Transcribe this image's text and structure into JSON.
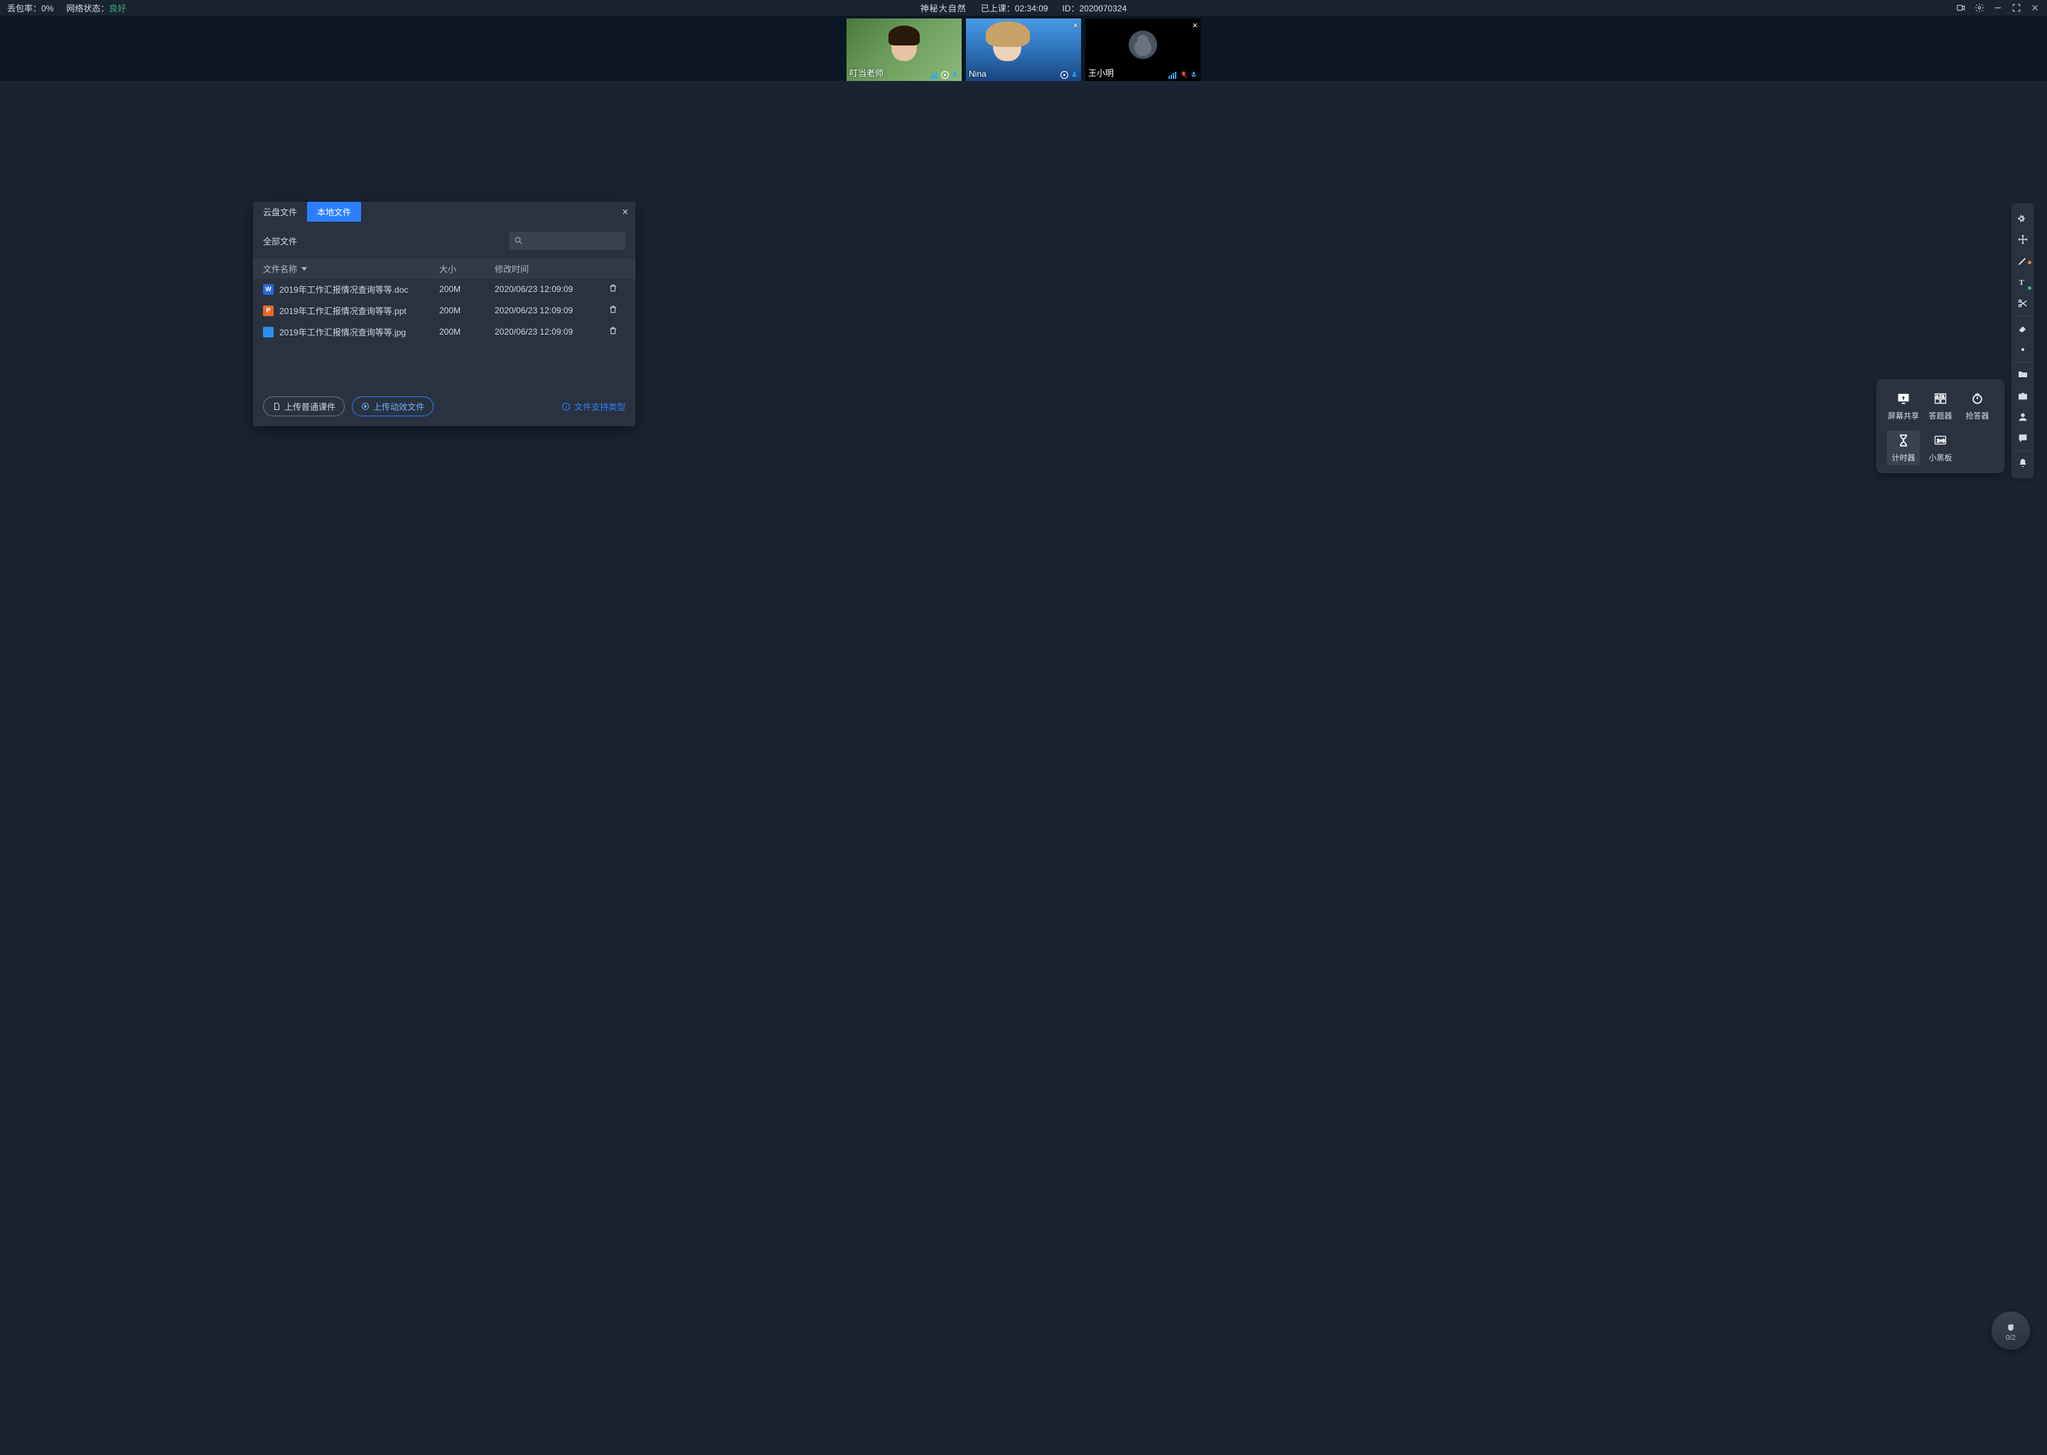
{
  "topbar": {
    "packet_loss_label": "丢包率：",
    "packet_loss_value": "0%",
    "network_label": "网络状态：",
    "network_value": "良好",
    "course_title": "神秘大自然",
    "elapsed_label": "已上课：",
    "elapsed_value": "02:34:09",
    "id_label": "ID：",
    "id_value": "2020070324"
  },
  "videos": [
    {
      "name": "叮当老师",
      "has_close": false,
      "camera_off": false,
      "mic_muted": false,
      "photo": 1
    },
    {
      "name": "Nina",
      "has_close": true,
      "camera_off": false,
      "mic_muted": false,
      "photo": 2
    },
    {
      "name": "王小明",
      "has_close": true,
      "camera_off": true,
      "mic_muted": true,
      "photo": 0
    }
  ],
  "modal": {
    "tab_cloud": "云盘文件",
    "tab_local": "本地文件",
    "all_files": "全部文件",
    "col_name": "文件名称",
    "col_size": "大小",
    "col_time": "修改时间",
    "rows": [
      {
        "icon": "w",
        "name": "2019年工作汇报情况查询等等.doc",
        "size": "200M",
        "time": "2020/06/23 12:09:09"
      },
      {
        "icon": "p",
        "name": "2019年工作汇报情况查询等等.ppt",
        "size": "200M",
        "time": "2020/06/23 12:09:09"
      },
      {
        "icon": "i",
        "name": "2019年工作汇报情况查询等等.jpg",
        "size": "200M",
        "time": "2020/06/23 12:09:09"
      }
    ],
    "btn_upload_normal": "上传普通课件",
    "btn_upload_anim": "上传动效文件",
    "link_supported": "文件支持类型"
  },
  "popup": {
    "screen_share": "屏幕共享",
    "quiz": "答题器",
    "responder": "抢答器",
    "timer": "计时器",
    "blackboard": "小黑板"
  },
  "hand": {
    "count": "0/2"
  }
}
